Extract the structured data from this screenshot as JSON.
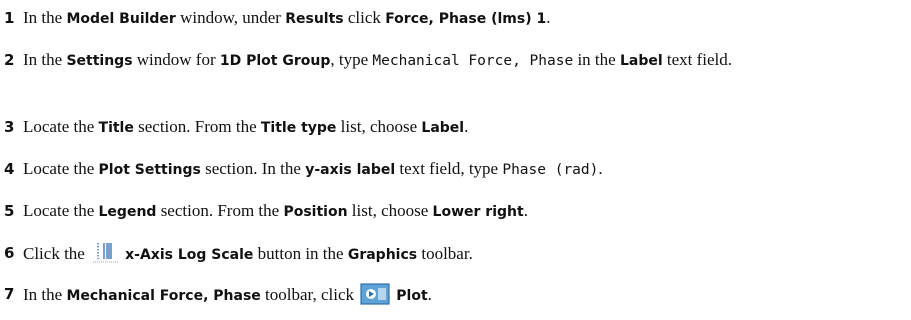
{
  "steps": [
    {
      "number": "1",
      "parts": [
        {
          "t": "In the "
        },
        {
          "t": "Model Builder",
          "ui": true
        },
        {
          "t": " window, under "
        },
        {
          "t": "Results",
          "ui": true
        },
        {
          "t": " click "
        },
        {
          "t": "Force, Phase (lms) 1",
          "ui": true
        },
        {
          "t": "."
        }
      ]
    },
    {
      "number": "2",
      "parts": [
        {
          "t": "In the "
        },
        {
          "t": "Settings",
          "ui": true
        },
        {
          "t": " window for "
        },
        {
          "t": "1D Plot Group",
          "ui": true
        },
        {
          "t": ", type "
        },
        {
          "t": "Mechanical Force, Phase",
          "code": true
        },
        {
          "t": " in the "
        },
        {
          "t": "Label",
          "ui": true
        },
        {
          "t": " text field."
        }
      ]
    },
    {
      "number": "3",
      "parts": [
        {
          "t": "Locate the "
        },
        {
          "t": "Title",
          "ui": true
        },
        {
          "t": " section. From the "
        },
        {
          "t": "Title type",
          "ui": true
        },
        {
          "t": " list, choose "
        },
        {
          "t": "Label",
          "ui": true
        },
        {
          "t": "."
        }
      ]
    },
    {
      "number": "4",
      "parts": [
        {
          "t": "Locate the "
        },
        {
          "t": "Plot Settings",
          "ui": true
        },
        {
          "t": " section. In the "
        },
        {
          "t": "y-axis label",
          "ui": true
        },
        {
          "t": " text field, type "
        },
        {
          "t": "Phase (rad)",
          "code": true
        },
        {
          "t": "."
        }
      ]
    },
    {
      "number": "5",
      "parts": [
        {
          "t": "Locate the "
        },
        {
          "t": "Legend",
          "ui": true
        },
        {
          "t": " section. From the "
        },
        {
          "t": "Position",
          "ui": true
        },
        {
          "t": " list, choose "
        },
        {
          "t": "Lower right",
          "ui": true
        },
        {
          "t": "."
        }
      ]
    },
    {
      "number": "6",
      "parts": [
        {
          "t": "Click the "
        },
        {
          "icon": "x-axis-log-scale-icon"
        },
        {
          "t": "x-Axis Log Scale",
          "ui": true
        },
        {
          "t": " button in the "
        },
        {
          "t": "Graphics",
          "ui": true
        },
        {
          "t": " toolbar."
        }
      ]
    },
    {
      "number": "7",
      "parts": [
        {
          "t": "In the "
        },
        {
          "t": "Mechanical Force, Phase",
          "ui": true
        },
        {
          "t": " toolbar, click "
        },
        {
          "icon": "plot-icon"
        },
        {
          "t": "Plot",
          "ui": true
        },
        {
          "t": "."
        }
      ]
    }
  ],
  "icon_colors": {
    "log_scale_lines": "#3b78c2",
    "log_scale_dots": "#9aa3ad",
    "plot_fill": "#5fa3d6",
    "plot_border": "#2f6fa8"
  }
}
